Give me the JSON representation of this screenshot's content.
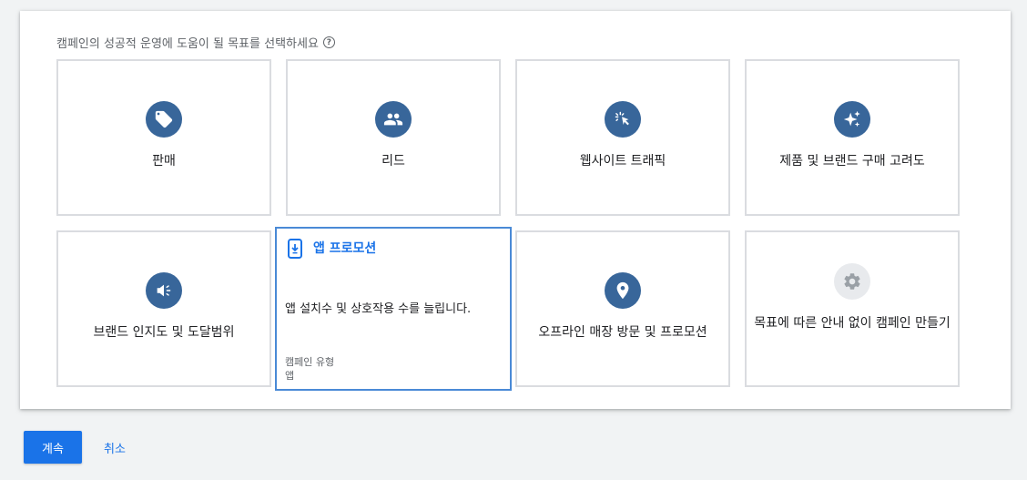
{
  "prompt": {
    "text": "캠페인의 성공적 운영에 도움이 될 목표를 선택하세요",
    "help_icon": "?"
  },
  "goals": [
    {
      "label": "판매",
      "icon": "tag-icon"
    },
    {
      "label": "리드",
      "icon": "people-icon"
    },
    {
      "label": "웹사이트 트래픽",
      "icon": "cursor-click-icon"
    },
    {
      "label": "제품 및 브랜드 구매 고려도",
      "icon": "sparkle-icon"
    },
    {
      "label": "브랜드 인지도 및 도달범위",
      "icon": "megaphone-icon"
    },
    {
      "label": "오프라인 매장 방문 및 프로모션",
      "icon": "location-pin-icon"
    },
    {
      "label": "목표에 따른 안내 없이 캠페인 만들기",
      "icon": "gear-icon"
    }
  ],
  "selected_goal": {
    "title": "앱 프로모션",
    "icon": "phone-download-icon",
    "description": "앱 설치수 및 상호작용 수를 늘립니다.",
    "campaign_type_label": "캠페인 유형",
    "campaign_type_value": "앱"
  },
  "actions": {
    "continue_label": "계속",
    "cancel_label": "취소"
  },
  "colors": {
    "icon_circle": "#38669a",
    "accent": "#1a73e8",
    "selected_border": "#4a8ad6",
    "card_border": "#dadce0"
  }
}
